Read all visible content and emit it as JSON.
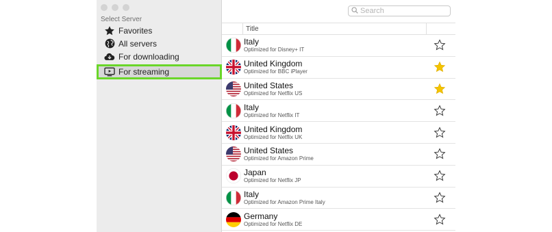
{
  "sidebar": {
    "heading": "Select Server",
    "items": [
      {
        "label": "Favorites",
        "icon": "star-icon"
      },
      {
        "label": "All servers",
        "icon": "globe-icon"
      },
      {
        "label": "For downloading",
        "icon": "cloud-download-icon"
      },
      {
        "label": "For streaming",
        "icon": "tv-play-icon",
        "selected": true
      }
    ]
  },
  "search": {
    "placeholder": "Search"
  },
  "table": {
    "column_title": "Title",
    "rows": [
      {
        "country": "Italy",
        "subtitle": "Optimized for Disney+ IT",
        "flag": "italy-flag-icon",
        "favorite": false
      },
      {
        "country": "United Kingdom",
        "subtitle": "Optimized for BBC iPlayer",
        "flag": "uk-flag-icon",
        "favorite": true
      },
      {
        "country": "United States",
        "subtitle": "Optimized for Netflix US",
        "flag": "us-flag-icon",
        "favorite": true
      },
      {
        "country": "Italy",
        "subtitle": "Optimized for Netflix IT",
        "flag": "italy-flag-icon",
        "favorite": false
      },
      {
        "country": "United Kingdom",
        "subtitle": "Optimized for Netflix UK",
        "flag": "uk-flag-icon",
        "favorite": false
      },
      {
        "country": "United States",
        "subtitle": "Optimized for Amazon Prime",
        "flag": "us-flag-icon",
        "favorite": false
      },
      {
        "country": "Japan",
        "subtitle": "Optimized for Netflix JP",
        "flag": "japan-flag-icon",
        "favorite": false
      },
      {
        "country": "Italy",
        "subtitle": "Optimized for Amazon Prime Italy",
        "flag": "italy-flag-icon",
        "favorite": false
      },
      {
        "country": "Germany",
        "subtitle": "Optimized for Netflix DE",
        "flag": "germany-flag-icon",
        "favorite": false
      }
    ]
  },
  "colors": {
    "selection_outline": "#6ad629",
    "favorite_star": "#f5c400",
    "sidebar_bg": "#ececec"
  }
}
